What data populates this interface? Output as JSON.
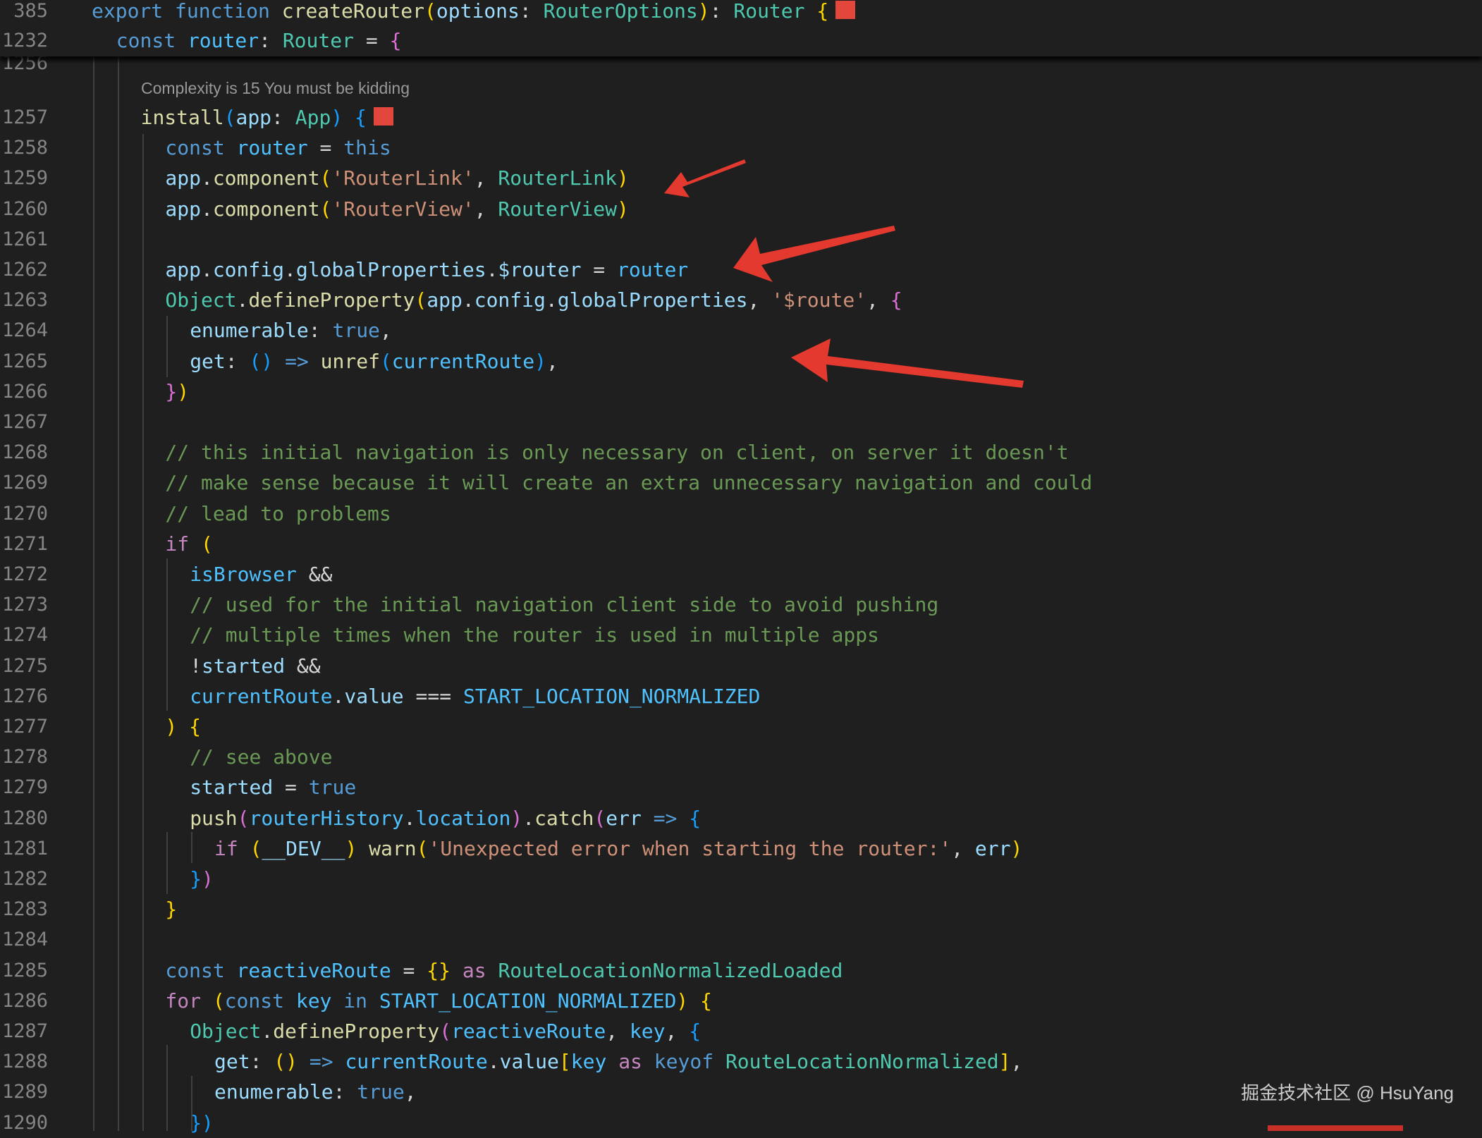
{
  "editor": {
    "sticky_lines": [
      {
        "num": "385",
        "indent": 0,
        "tokens": [
          {
            "t": "export ",
            "c": "kw"
          },
          {
            "t": "function ",
            "c": "kw"
          },
          {
            "t": "createRouter",
            "c": "fn"
          },
          {
            "t": "(",
            "c": "b1"
          },
          {
            "t": "options",
            "c": "var"
          },
          {
            "t": ": ",
            "c": "pl"
          },
          {
            "t": "RouterOptions",
            "c": "ty"
          },
          {
            "t": ")",
            "c": "b1"
          },
          {
            "t": ": ",
            "c": "pl"
          },
          {
            "t": "Router",
            "c": "ty"
          },
          {
            "t": " {",
            "c": "b1"
          }
        ],
        "marker": true
      },
      {
        "num": "1232",
        "indent": 1,
        "tokens": [
          {
            "t": "const ",
            "c": "kw"
          },
          {
            "t": "router",
            "c": "cst"
          },
          {
            "t": ": ",
            "c": "pl"
          },
          {
            "t": "Router",
            "c": "ty"
          },
          {
            "t": " = ",
            "c": "pl"
          },
          {
            "t": "{",
            "c": "b2"
          }
        ]
      }
    ],
    "partial_top_num": "1256",
    "code_lens": "Complexity is 15 You must be kidding",
    "lines": [
      {
        "num": "1257",
        "indent": 2,
        "marker": true,
        "tokens": [
          {
            "t": "install",
            "c": "fn"
          },
          {
            "t": "(",
            "c": "b3"
          },
          {
            "t": "app",
            "c": "var"
          },
          {
            "t": ": ",
            "c": "pl"
          },
          {
            "t": "App",
            "c": "ty"
          },
          {
            "t": ")",
            "c": "b3"
          },
          {
            "t": " {",
            "c": "b3"
          }
        ]
      },
      {
        "num": "1258",
        "indent": 3,
        "tokens": [
          {
            "t": "const ",
            "c": "kw"
          },
          {
            "t": "router",
            "c": "cst"
          },
          {
            "t": " = ",
            "c": "pl"
          },
          {
            "t": "this",
            "c": "kw"
          }
        ]
      },
      {
        "num": "1259",
        "indent": 3,
        "tokens": [
          {
            "t": "app",
            "c": "var"
          },
          {
            "t": ".",
            "c": "pl"
          },
          {
            "t": "component",
            "c": "fn"
          },
          {
            "t": "(",
            "c": "b1"
          },
          {
            "t": "'RouterLink'",
            "c": "str"
          },
          {
            "t": ", ",
            "c": "pl"
          },
          {
            "t": "RouterLink",
            "c": "ty"
          },
          {
            "t": ")",
            "c": "b1"
          }
        ]
      },
      {
        "num": "1260",
        "indent": 3,
        "tokens": [
          {
            "t": "app",
            "c": "var"
          },
          {
            "t": ".",
            "c": "pl"
          },
          {
            "t": "component",
            "c": "fn"
          },
          {
            "t": "(",
            "c": "b1"
          },
          {
            "t": "'RouterView'",
            "c": "str"
          },
          {
            "t": ", ",
            "c": "pl"
          },
          {
            "t": "RouterView",
            "c": "ty"
          },
          {
            "t": ")",
            "c": "b1"
          }
        ]
      },
      {
        "num": "1261",
        "indent": 3,
        "tokens": []
      },
      {
        "num": "1262",
        "indent": 3,
        "tokens": [
          {
            "t": "app",
            "c": "var"
          },
          {
            "t": ".",
            "c": "pl"
          },
          {
            "t": "config",
            "c": "var"
          },
          {
            "t": ".",
            "c": "pl"
          },
          {
            "t": "globalProperties",
            "c": "var"
          },
          {
            "t": ".",
            "c": "pl"
          },
          {
            "t": "$router",
            "c": "var"
          },
          {
            "t": " = ",
            "c": "pl"
          },
          {
            "t": "router",
            "c": "cst"
          }
        ]
      },
      {
        "num": "1263",
        "indent": 3,
        "tokens": [
          {
            "t": "Object",
            "c": "ty"
          },
          {
            "t": ".",
            "c": "pl"
          },
          {
            "t": "defineProperty",
            "c": "fn"
          },
          {
            "t": "(",
            "c": "b1"
          },
          {
            "t": "app",
            "c": "var"
          },
          {
            "t": ".",
            "c": "pl"
          },
          {
            "t": "config",
            "c": "var"
          },
          {
            "t": ".",
            "c": "pl"
          },
          {
            "t": "globalProperties",
            "c": "var"
          },
          {
            "t": ", ",
            "c": "pl"
          },
          {
            "t": "'$route'",
            "c": "str"
          },
          {
            "t": ", ",
            "c": "pl"
          },
          {
            "t": "{",
            "c": "b2"
          }
        ]
      },
      {
        "num": "1264",
        "indent": 4,
        "tokens": [
          {
            "t": "enumerable",
            "c": "var"
          },
          {
            "t": ": ",
            "c": "pl"
          },
          {
            "t": "true",
            "c": "kw"
          },
          {
            "t": ",",
            "c": "pl"
          }
        ]
      },
      {
        "num": "1265",
        "indent": 4,
        "tokens": [
          {
            "t": "get",
            "c": "var"
          },
          {
            "t": ": ",
            "c": "pl"
          },
          {
            "t": "()",
            "c": "b3"
          },
          {
            "t": " ",
            "c": "pl"
          },
          {
            "t": "=>",
            "c": "kw"
          },
          {
            "t": " ",
            "c": "pl"
          },
          {
            "t": "unref",
            "c": "fn"
          },
          {
            "t": "(",
            "c": "b3"
          },
          {
            "t": "currentRoute",
            "c": "cst"
          },
          {
            "t": ")",
            "c": "b3"
          },
          {
            "t": ",",
            "c": "pl"
          }
        ]
      },
      {
        "num": "1266",
        "indent": 3,
        "tokens": [
          {
            "t": "}",
            "c": "b2"
          },
          {
            "t": ")",
            "c": "b1"
          }
        ]
      },
      {
        "num": "1267",
        "indent": 3,
        "tokens": []
      },
      {
        "num": "1268",
        "indent": 3,
        "tokens": [
          {
            "t": "// this initial navigation is only necessary on client, on server it doesn't",
            "c": "cm"
          }
        ]
      },
      {
        "num": "1269",
        "indent": 3,
        "tokens": [
          {
            "t": "// make sense because it will create an extra unnecessary navigation and could",
            "c": "cm"
          }
        ]
      },
      {
        "num": "1270",
        "indent": 3,
        "tokens": [
          {
            "t": "// lead to problems",
            "c": "cm"
          }
        ]
      },
      {
        "num": "1271",
        "indent": 3,
        "tokens": [
          {
            "t": "if",
            "c": "kw2"
          },
          {
            "t": " (",
            "c": "b1"
          }
        ]
      },
      {
        "num": "1272",
        "indent": 4,
        "tokens": [
          {
            "t": "isBrowser",
            "c": "cst"
          },
          {
            "t": " &&",
            "c": "pl"
          }
        ]
      },
      {
        "num": "1273",
        "indent": 4,
        "tokens": [
          {
            "t": "// used for the initial navigation client side to avoid pushing",
            "c": "cm"
          }
        ]
      },
      {
        "num": "1274",
        "indent": 4,
        "tokens": [
          {
            "t": "// multiple times when the router is used in multiple apps",
            "c": "cm"
          }
        ]
      },
      {
        "num": "1275",
        "indent": 4,
        "tokens": [
          {
            "t": "!",
            "c": "pl"
          },
          {
            "t": "started",
            "c": "var"
          },
          {
            "t": " &&",
            "c": "pl"
          }
        ]
      },
      {
        "num": "1276",
        "indent": 4,
        "tokens": [
          {
            "t": "currentRoute",
            "c": "cst"
          },
          {
            "t": ".",
            "c": "pl"
          },
          {
            "t": "value",
            "c": "var"
          },
          {
            "t": " === ",
            "c": "pl"
          },
          {
            "t": "START_LOCATION_NORMALIZED",
            "c": "cst"
          }
        ]
      },
      {
        "num": "1277",
        "indent": 3,
        "tokens": [
          {
            "t": ")",
            "c": "b1"
          },
          {
            "t": " {",
            "c": "b1"
          }
        ]
      },
      {
        "num": "1278",
        "indent": 4,
        "tokens": [
          {
            "t": "// see above",
            "c": "cm"
          }
        ]
      },
      {
        "num": "1279",
        "indent": 4,
        "tokens": [
          {
            "t": "started",
            "c": "var"
          },
          {
            "t": " = ",
            "c": "pl"
          },
          {
            "t": "true",
            "c": "kw"
          }
        ]
      },
      {
        "num": "1280",
        "indent": 4,
        "tokens": [
          {
            "t": "push",
            "c": "fn"
          },
          {
            "t": "(",
            "c": "b2"
          },
          {
            "t": "routerHistory",
            "c": "cst"
          },
          {
            "t": ".",
            "c": "pl"
          },
          {
            "t": "location",
            "c": "cst"
          },
          {
            "t": ")",
            "c": "b2"
          },
          {
            "t": ".",
            "c": "pl"
          },
          {
            "t": "catch",
            "c": "fn"
          },
          {
            "t": "(",
            "c": "b2"
          },
          {
            "t": "err",
            "c": "var"
          },
          {
            "t": " ",
            "c": "pl"
          },
          {
            "t": "=>",
            "c": "kw"
          },
          {
            "t": " {",
            "c": "b3"
          }
        ]
      },
      {
        "num": "1281",
        "indent": 5,
        "tokens": [
          {
            "t": "if",
            "c": "kw2"
          },
          {
            "t": " (",
            "c": "b1"
          },
          {
            "t": "__DEV__",
            "c": "var"
          },
          {
            "t": ")",
            "c": "b1"
          },
          {
            "t": " ",
            "c": "pl"
          },
          {
            "t": "warn",
            "c": "fn"
          },
          {
            "t": "(",
            "c": "b1"
          },
          {
            "t": "'Unexpected error when starting the router:'",
            "c": "str"
          },
          {
            "t": ", ",
            "c": "pl"
          },
          {
            "t": "err",
            "c": "var"
          },
          {
            "t": ")",
            "c": "b1"
          }
        ]
      },
      {
        "num": "1282",
        "indent": 4,
        "tokens": [
          {
            "t": "}",
            "c": "b3"
          },
          {
            "t": ")",
            "c": "b2"
          }
        ]
      },
      {
        "num": "1283",
        "indent": 3,
        "tokens": [
          {
            "t": "}",
            "c": "b1"
          }
        ]
      },
      {
        "num": "1284",
        "indent": 3,
        "tokens": []
      },
      {
        "num": "1285",
        "indent": 3,
        "tokens": [
          {
            "t": "const ",
            "c": "kw"
          },
          {
            "t": "reactiveRoute",
            "c": "cst"
          },
          {
            "t": " = ",
            "c": "pl"
          },
          {
            "t": "{}",
            "c": "b1"
          },
          {
            "t": " ",
            "c": "pl"
          },
          {
            "t": "as",
            "c": "kw2"
          },
          {
            "t": " ",
            "c": "pl"
          },
          {
            "t": "RouteLocationNormalizedLoaded",
            "c": "ty"
          }
        ]
      },
      {
        "num": "1286",
        "indent": 3,
        "tokens": [
          {
            "t": "for",
            "c": "kw2"
          },
          {
            "t": " (",
            "c": "b1"
          },
          {
            "t": "const ",
            "c": "kw"
          },
          {
            "t": "key",
            "c": "cst"
          },
          {
            "t": " ",
            "c": "pl"
          },
          {
            "t": "in",
            "c": "kw"
          },
          {
            "t": " ",
            "c": "pl"
          },
          {
            "t": "START_LOCATION_NORMALIZED",
            "c": "cst"
          },
          {
            "t": ")",
            "c": "b1"
          },
          {
            "t": " {",
            "c": "b1"
          }
        ]
      },
      {
        "num": "1287",
        "indent": 4,
        "tokens": [
          {
            "t": "Object",
            "c": "ty"
          },
          {
            "t": ".",
            "c": "pl"
          },
          {
            "t": "defineProperty",
            "c": "fn"
          },
          {
            "t": "(",
            "c": "b2"
          },
          {
            "t": "reactiveRoute",
            "c": "cst"
          },
          {
            "t": ", ",
            "c": "pl"
          },
          {
            "t": "key",
            "c": "cst"
          },
          {
            "t": ", ",
            "c": "pl"
          },
          {
            "t": "{",
            "c": "b3"
          }
        ]
      },
      {
        "num": "1288",
        "indent": 5,
        "tokens": [
          {
            "t": "get",
            "c": "var"
          },
          {
            "t": ": ",
            "c": "pl"
          },
          {
            "t": "()",
            "c": "b1"
          },
          {
            "t": " ",
            "c": "pl"
          },
          {
            "t": "=>",
            "c": "kw"
          },
          {
            "t": " ",
            "c": "pl"
          },
          {
            "t": "currentRoute",
            "c": "cst"
          },
          {
            "t": ".",
            "c": "pl"
          },
          {
            "t": "value",
            "c": "var"
          },
          {
            "t": "[",
            "c": "b1"
          },
          {
            "t": "key",
            "c": "cst"
          },
          {
            "t": " ",
            "c": "pl"
          },
          {
            "t": "as",
            "c": "kw2"
          },
          {
            "t": " ",
            "c": "pl"
          },
          {
            "t": "keyof",
            "c": "kw"
          },
          {
            "t": " ",
            "c": "pl"
          },
          {
            "t": "RouteLocationNormalized",
            "c": "ty"
          },
          {
            "t": "]",
            "c": "b1"
          },
          {
            "t": ",",
            "c": "pl"
          }
        ]
      },
      {
        "num": "1289",
        "indent": 5,
        "tokens": [
          {
            "t": "enumerable",
            "c": "var"
          },
          {
            "t": ": ",
            "c": "pl"
          },
          {
            "t": "true",
            "c": "kw"
          },
          {
            "t": ",",
            "c": "pl"
          }
        ]
      },
      {
        "num": "1290",
        "indent": 4,
        "tokens": [
          {
            "t": "})",
            "c": "b3"
          }
        ]
      }
    ]
  },
  "watermark": "掘金技术社区 @ HsuYang",
  "colors": {
    "background": "#1f1f1f",
    "annotation_arrow": "#e3392f",
    "marker_square": "#e3463b"
  },
  "annotations": [
    "red-arrow",
    "red-arrow",
    "red-arrow"
  ]
}
